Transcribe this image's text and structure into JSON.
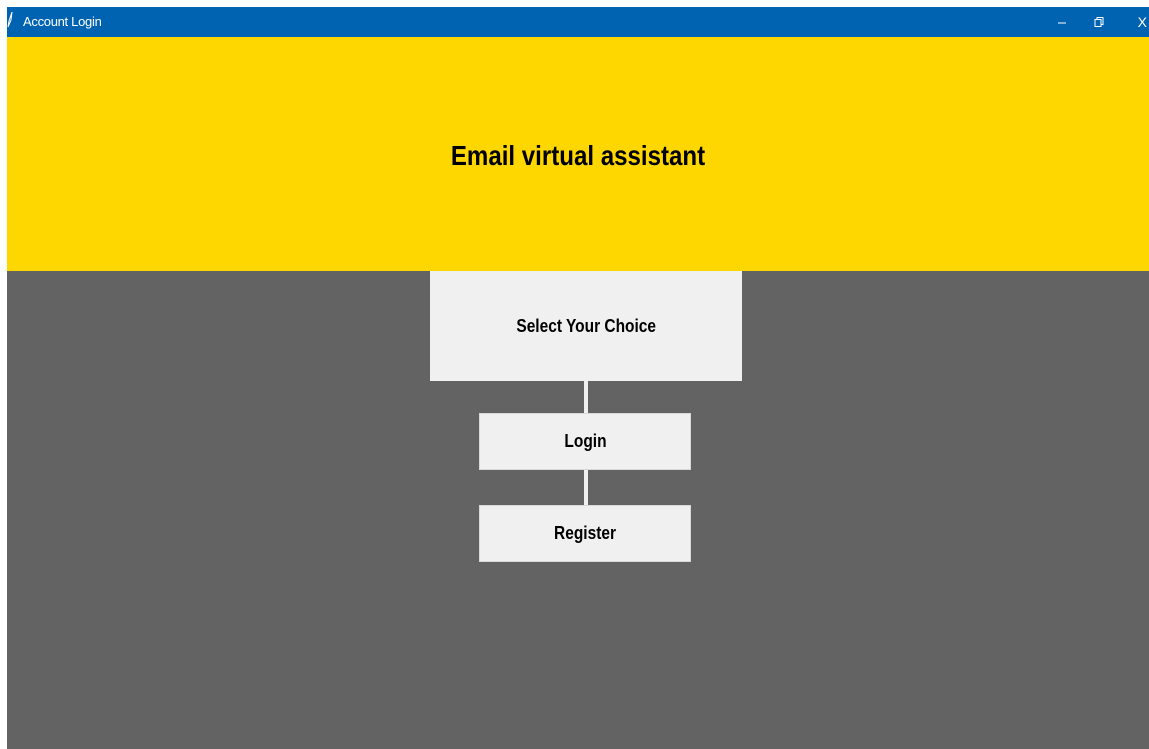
{
  "window": {
    "title": "Account Login",
    "controls": {
      "minimize_icon": "minimize-icon",
      "restore_icon": "restore-icon",
      "close_label": "X"
    }
  },
  "header": {
    "title": "Email virtual assistant"
  },
  "main": {
    "choice_label": "Select Your Choice",
    "buttons": {
      "login": "Login",
      "register": "Register"
    }
  },
  "colors": {
    "titlebar": "#0063b1",
    "header_bg": "#ffd700",
    "body_bg": "#636363",
    "panel_bg": "#f0f0f0"
  }
}
